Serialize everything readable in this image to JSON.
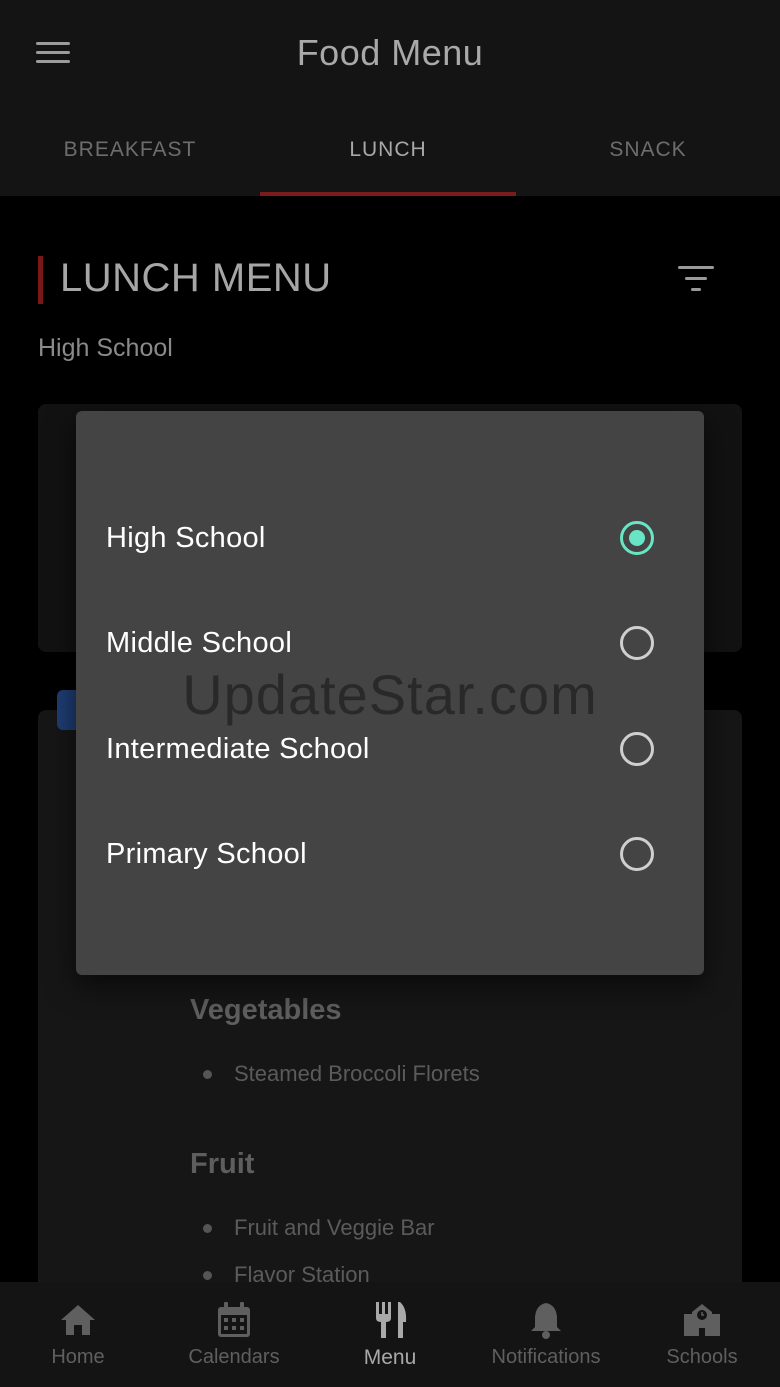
{
  "app_title": "Food Menu",
  "tabs": [
    {
      "label": "BREAKFAST"
    },
    {
      "label": "LUNCH"
    },
    {
      "label": "SNACK"
    }
  ],
  "section": {
    "title": "LUNCH MENU",
    "school": "High School"
  },
  "menu": {
    "categories": [
      {
        "name": "Vegetables",
        "items": [
          "Steamed Broccoli Florets"
        ]
      },
      {
        "name": "Fruit",
        "items": [
          "Fruit and Veggie Bar",
          "Flavor Station"
        ]
      }
    ]
  },
  "dialog": {
    "options": [
      {
        "label": "High School",
        "selected": true
      },
      {
        "label": "Middle School",
        "selected": false
      },
      {
        "label": "Intermediate School",
        "selected": false
      },
      {
        "label": "Primary School",
        "selected": false
      }
    ]
  },
  "watermark": "UpdateStar.com",
  "bottom_nav": [
    {
      "label": "Home",
      "icon": "home-icon"
    },
    {
      "label": "Calendars",
      "icon": "calendar-icon"
    },
    {
      "label": "Menu",
      "icon": "fork-knife-icon"
    },
    {
      "label": "Notifications",
      "icon": "bell-icon"
    },
    {
      "label": "Schools",
      "icon": "school-icon"
    }
  ],
  "colors": {
    "accent_red": "#7a1c1c",
    "radio_selected": "#68e5c4",
    "dialog_bg": "#444444"
  }
}
